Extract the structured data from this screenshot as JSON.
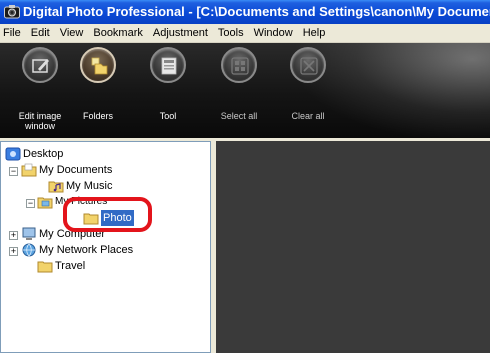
{
  "window": {
    "title": "Digital Photo Professional - [C:\\Documents and Settings\\canon\\My Documents\\My Pictures\\Photo]"
  },
  "menu": {
    "items": [
      "File",
      "Edit",
      "View",
      "Bookmark",
      "Adjustment",
      "Tools",
      "Window",
      "Help"
    ]
  },
  "toolbar": {
    "buttons": [
      {
        "label": "Edit image window",
        "icon": "edit-image-icon"
      },
      {
        "label": "Folders",
        "icon": "folders-icon"
      },
      {
        "label": "Tool",
        "icon": "tool-icon"
      },
      {
        "label": "Select all",
        "icon": "select-all-icon"
      },
      {
        "label": "Clear all",
        "icon": "clear-all-icon"
      }
    ]
  },
  "tree": {
    "desktop": "Desktop",
    "my_documents": "My Documents",
    "my_music": "My Music",
    "my_pictures": "My Pictures",
    "photo": "Photo",
    "my_computer": "My Computer",
    "my_network_places": "My Network Places",
    "travel": "Travel",
    "selected": "Photo"
  },
  "colors": {
    "title_bar": "#0a49d6",
    "selection": "#316ac5",
    "highlight_ring": "#e3141b",
    "toolbar_bg": "#141414",
    "content_bg": "#3a3a3a"
  }
}
